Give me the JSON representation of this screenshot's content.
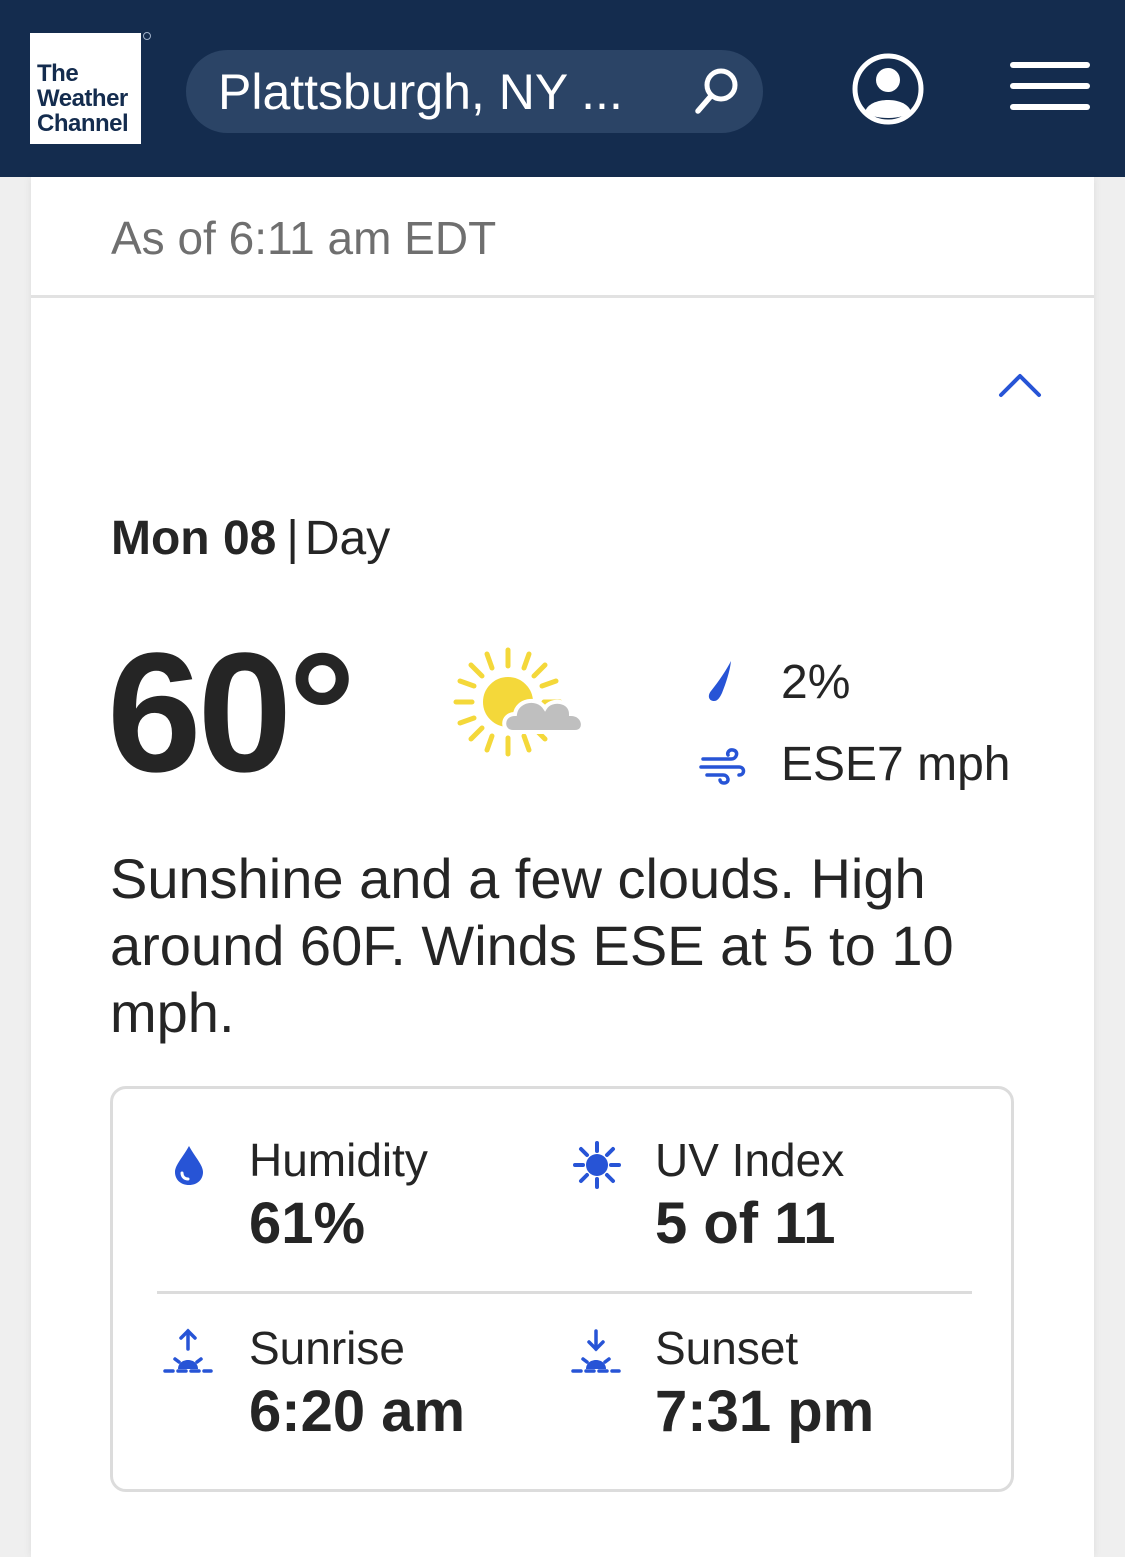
{
  "header": {
    "logo": {
      "line1": "The",
      "line2": "Weather",
      "line3": "Channel"
    },
    "search": {
      "location": "Plattsburgh, NY ..."
    },
    "icons": {
      "search": "search-icon",
      "account": "account-icon",
      "menu": "menu-icon"
    },
    "colors": {
      "background": "#142c4e",
      "search_pill": "#2b4466"
    }
  },
  "card": {
    "as_of": "As of 6:11 am EDT",
    "day": {
      "date": "Mon 08",
      "separator": "|",
      "period": "Day"
    },
    "temperature": "60°",
    "condition_icon": "sun-with-clouds-icon",
    "precip": {
      "icon": "raindrop-icon",
      "value": "2%"
    },
    "wind": {
      "icon": "wind-icon",
      "value": "ESE7 mph"
    },
    "narrative": "Sunshine and a few clouds. High around 60F. Winds ESE at 5 to 10 mph.",
    "details": {
      "humidity": {
        "label": "Humidity",
        "value": "61%"
      },
      "uv_index": {
        "label": "UV Index",
        "value": "5 of 11"
      },
      "sunrise": {
        "label": "Sunrise",
        "value": "6:20 am"
      },
      "sunset": {
        "label": "Sunset",
        "value": "7:31 pm"
      }
    },
    "colors": {
      "accent": "#2754d6",
      "sun": "#f4d83a",
      "cloud": "#bfbfbf"
    }
  }
}
